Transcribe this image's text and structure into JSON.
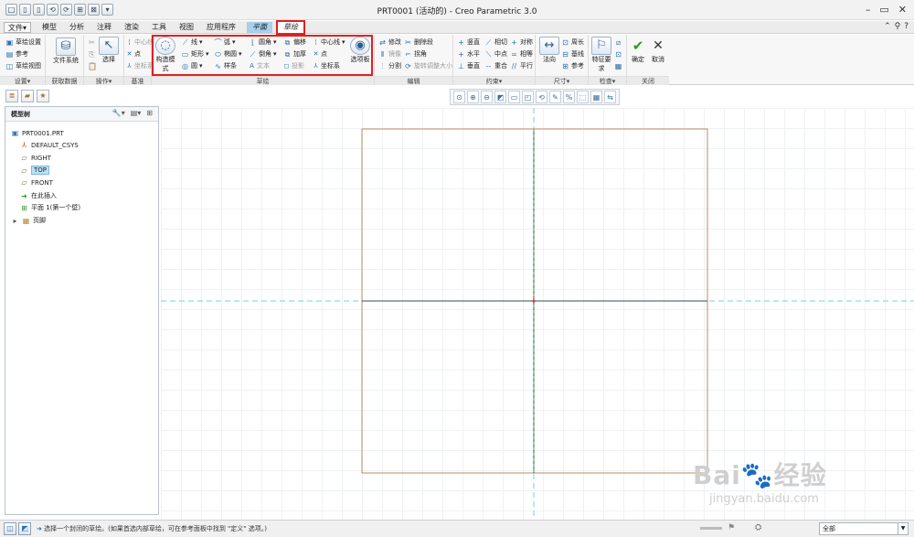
{
  "window": {
    "title": "PRT0001 (活动的) - Creo Parametric 3.0",
    "quick_access": [
      "□",
      "▯",
      "▯",
      "⟲",
      "⟳",
      "⊞",
      "⊠",
      "▾"
    ],
    "controls": [
      "–",
      "▭",
      "✕"
    ]
  },
  "menu": {
    "file": "文件▾",
    "tabs": [
      "模型",
      "分析",
      "注释",
      "渲染",
      "工具",
      "视图",
      "应用程序"
    ],
    "app_tab": "平面",
    "sketch_tab": "草绘"
  },
  "ribbon": {
    "setup": {
      "items": [
        "草绘设置",
        "参考",
        "草绘视图"
      ],
      "label": "设置▾"
    },
    "getdata": {
      "button": "文件系统",
      "label": "获取数据"
    },
    "operations": {
      "select": "选择",
      "label": "操作▾"
    },
    "datum": {
      "items": [
        "中心线",
        "点",
        "坐标系"
      ],
      "label": "基准"
    },
    "sketching": {
      "construction": "构造模式",
      "col1": [
        "线",
        "矩形",
        "圆"
      ],
      "col2": [
        "弧",
        "椭圆",
        "样条"
      ],
      "col3": [
        "圆角",
        "倒角",
        "文本"
      ],
      "col4": [
        "偏移",
        "加厚",
        "投影"
      ],
      "col5": [
        "中心线",
        "点",
        "坐标系"
      ],
      "palette": "选项板",
      "label": "草绘"
    },
    "editing": {
      "col1": [
        "修改",
        "镜像",
        "分割"
      ],
      "col2": [
        "删除段",
        "拐角",
        "旋转调整大小"
      ],
      "label": "编辑"
    },
    "constrain": {
      "col1": [
        "竖直",
        "水平",
        "垂直"
      ],
      "col2": [
        "相切",
        "中点",
        "重合"
      ],
      "col3": [
        "对称",
        "相等",
        "平行"
      ],
      "label": "约束▾"
    },
    "dimension": {
      "normal": "法向",
      "col": [
        "周长",
        "基线",
        "参考"
      ],
      "label": "尺寸▾"
    },
    "inspect": {
      "feature": "特征要求",
      "label": "检查▾"
    },
    "close": {
      "ok": "确定",
      "cancel": "取消",
      "label": "关闭"
    }
  },
  "graphics_toolbar": [
    "⊙",
    "⊕",
    "⊖",
    "◩",
    "▭",
    "◰",
    "⟲",
    "✎",
    "%",
    "⬚",
    "▦",
    "⇆"
  ],
  "model_tree": {
    "title": "模型树",
    "items": [
      {
        "label": "PRT0001.PRT",
        "icon": "part-icon"
      },
      {
        "label": "DEFAULT_CSYS",
        "icon": "csys-icon"
      },
      {
        "label": "RIGHT",
        "icon": "plane-icon"
      },
      {
        "label": "TOP",
        "icon": "plane-icon",
        "selected": true
      },
      {
        "label": "FRONT",
        "icon": "plane-icon"
      },
      {
        "label": "在此插入",
        "icon": "insert-arrow-icon"
      },
      {
        "label": "平面 1(第一个壁)",
        "icon": "sheetmetal-wall-icon"
      },
      {
        "label": "页脚",
        "icon": "footer-icon"
      }
    ]
  },
  "status": {
    "message": "选择一个封闭的草绘。(如果首选内部草绘，可在参考面板中找到 \"定义\" 选项。)",
    "filter": "全部"
  },
  "watermark": {
    "logo": "Bai🐾经验",
    "url": "jingyan.baidu.com"
  },
  "colors": {
    "sketch_tab_highlight": "#e02020",
    "app_tab_bg": "#a9cfe9",
    "sketch_frame": "#c08a60",
    "reference_axis": "#6fd3e6"
  }
}
